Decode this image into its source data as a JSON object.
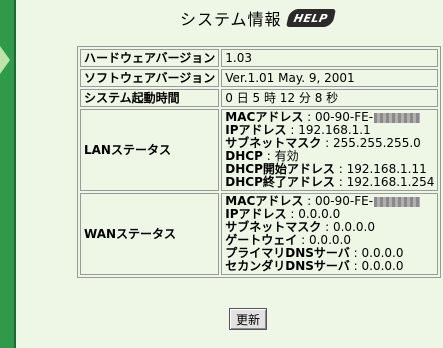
{
  "page": {
    "title": "システム情報",
    "help_label": "HELP"
  },
  "rows": {
    "hardware": {
      "label": "ハードウェアバージョン",
      "value": "1.03"
    },
    "software": {
      "label": "ソフトウェアバージョン",
      "value": "Ver.1.01 May. 9, 2001"
    },
    "uptime": {
      "label": "システム起動時間",
      "value": "0 日 5 時 12 分 8 秒"
    }
  },
  "lan": {
    "label": "LANステータス",
    "mac_key": "MACアドレス",
    "mac_value": ": 00-90-FE-",
    "ip_key": "IPアドレス",
    "ip_value": ": 192.168.1.1",
    "subnet_key": "サブネットマスク",
    "subnet_value": ": 255.255.255.0",
    "dhcp_key": "DHCP",
    "dhcp_value": ": 有効",
    "dhcp_start_key": "DHCP開始アドレス",
    "dhcp_start_value": ": 192.168.1.11",
    "dhcp_end_key": "DHCP終了アドレス",
    "dhcp_end_value": ": 192.168.1.254"
  },
  "wan": {
    "label": "WANステータス",
    "mac_key": "MACアドレス",
    "mac_value": ": 00-90-FE-",
    "ip_key": "IPアドレス",
    "ip_value": ": 0.0.0.0",
    "subnet_key": "サブネットマスク",
    "subnet_value": ": 0.0.0.0",
    "gateway_key": "ゲートウェイ",
    "gateway_value": ": 0.0.0.0",
    "dns1_key": "プライマリDNSサーバ",
    "dns1_value": ": 0.0.0.0",
    "dns2_key": "セカンダリDNSサーバ",
    "dns2_value": ": 0.0.0.0"
  },
  "buttons": {
    "refresh_label": "更新"
  },
  "colors": {
    "background": "#eef7e6",
    "nav_green": "#2f9a4a"
  }
}
